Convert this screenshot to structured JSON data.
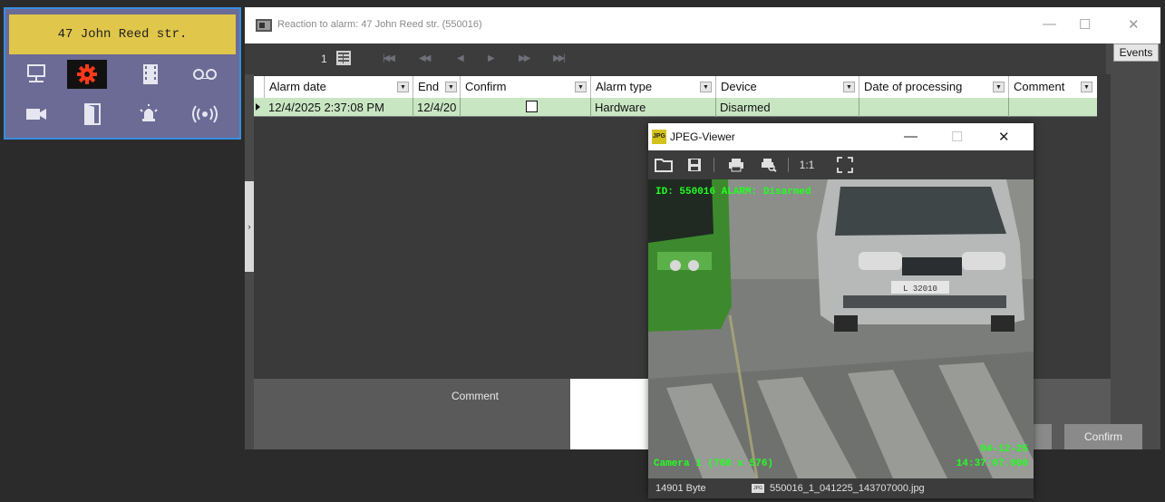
{
  "object_panel": {
    "title": "47 John Reed str.",
    "icons": [
      "network-icon",
      "settings-icon",
      "film-icon",
      "voicemail-icon",
      "camera-icon",
      "door-icon",
      "alarm-bell-icon",
      "sensor-icon"
    ],
    "accent_color": "#3a8de0",
    "title_bg": "#e0c64a"
  },
  "window": {
    "title": "Reaction to alarm: 47 John Reed str. (550016)",
    "events_label": "Events",
    "minimize": "—",
    "maximize": "☐",
    "close": "✕"
  },
  "navigator": {
    "page": "1",
    "buttons": [
      "first",
      "prev-page",
      "prev",
      "next",
      "next-page",
      "last"
    ],
    "glyphs": [
      "|◀◀",
      "◀◀",
      "◀",
      "▶",
      "▶▶",
      "▶▶|"
    ]
  },
  "grid": {
    "columns": [
      "Alarm date",
      "End",
      "Confirm",
      "Alarm type",
      "Device",
      "Date of processing",
      "Comment"
    ],
    "rows": [
      {
        "alarm_date": "12/4/2025 2:37:08 PM",
        "end": "12/4/20",
        "confirm": false,
        "alarm_type": "Hardware",
        "device": "Disarmed",
        "date_of_processing": "",
        "comment": ""
      }
    ],
    "row_color": "#c9e6c3"
  },
  "comment_section": {
    "label": "Comment",
    "confirm_label": "Confirm"
  },
  "jpeg_viewer": {
    "title": "JPEG-Viewer",
    "app_icon": "JPG",
    "toolbar": [
      "open-icon",
      "save-icon",
      "print-icon",
      "print-preview-icon",
      "actual-size-icon",
      "fullscreen-icon"
    ],
    "actual_size_label": "1:1",
    "overlay_top": "ID: 550016  ALARM: Disarmed",
    "overlay_camera": "Camera 1 (768 x 576)",
    "overlay_date": "04-12-25",
    "overlay_time": "14:37:07.000",
    "plate": "L 32010",
    "file_size": "14901 Byte",
    "file_icon": "JPG",
    "file_name": "550016_1_041225_143707000.jpg",
    "overlay_color": "#22ff22"
  }
}
